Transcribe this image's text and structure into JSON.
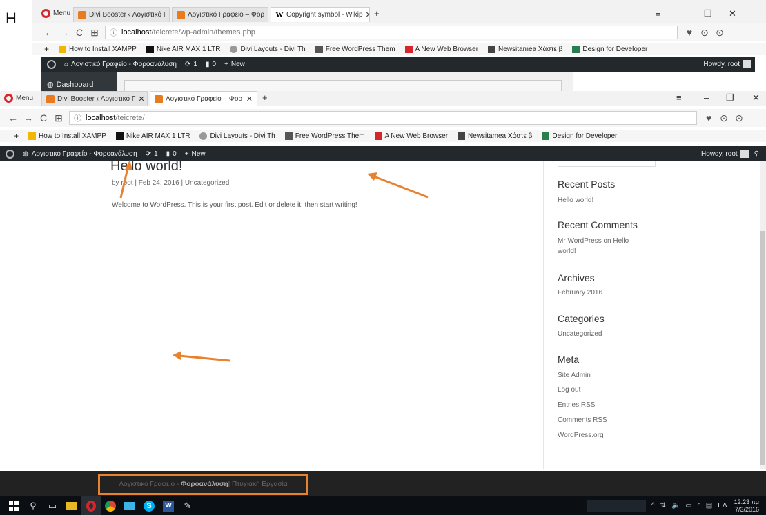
{
  "corner_letter": "H",
  "back_window": {
    "menu_label": "Menu",
    "tabs": [
      {
        "title": "Divi Booster ‹ Λογιστικό Γ",
        "icon": "orange-favicon",
        "active": false
      },
      {
        "title": "Λογιστικό Γραφείο – Φορ",
        "icon": "orange-favicon",
        "active": false
      },
      {
        "title": "Copyright symbol - Wikip",
        "icon": "wiki-favicon",
        "active": true
      }
    ],
    "url": {
      "domain": "localhost",
      "path": "/teicrete/wp-admin/themes.php"
    },
    "bookmarks": [
      {
        "label": "How to Install XAMPP",
        "icon_color": "#f2b705"
      },
      {
        "label": "Nike AIR MAX 1 LTR",
        "icon_color": "#111111"
      },
      {
        "label": "Divi Layouts - Divi Th",
        "icon_color": "#999999"
      },
      {
        "label": "Free WordPress Them",
        "icon_color": "#555555"
      },
      {
        "label": "A New Web Browser",
        "icon_color": "#d6262b"
      },
      {
        "label": "Newsitamea Χάστε β",
        "icon_color": "#444444"
      },
      {
        "label": "Design for Developer",
        "icon_color": "#2a7d4f"
      }
    ],
    "admin_bar": {
      "site": "Λογιστικό Γραφείο - Φοροανάλυση",
      "updates": "1",
      "comments": "0",
      "new": "New",
      "howdy": "Howdy, root"
    },
    "dashboard_label": "Dashboard"
  },
  "front_window": {
    "menu_label": "Menu",
    "tabs": [
      {
        "title": "Divi Booster ‹ Λογιστικό Γ",
        "active": false
      },
      {
        "title": "Λογιστικό Γραφείο – Φορ",
        "active": true
      }
    ],
    "url": {
      "domain": "localhost",
      "path": "/teicrete/"
    },
    "bookmarks": [
      {
        "label": "How to Install XAMPP",
        "icon_color": "#f2b705"
      },
      {
        "label": "Nike AIR MAX 1 LTR",
        "icon_color": "#111111"
      },
      {
        "label": "Divi Layouts - Divi Th",
        "icon_color": "#999999"
      },
      {
        "label": "Free WordPress Them",
        "icon_color": "#555555"
      },
      {
        "label": "A New Web Browser",
        "icon_color": "#d6262b"
      },
      {
        "label": "Newsitamea Χάστε β",
        "icon_color": "#444444"
      },
      {
        "label": "Design for Developer",
        "icon_color": "#2a7d4f"
      }
    ],
    "admin_bar": {
      "site": "Λογιστικό Γραφείο - Φοροανάλυση",
      "updates": "1",
      "comments": "0",
      "new": "New",
      "howdy": "Howdy, root"
    }
  },
  "post": {
    "title": "Hello world!",
    "meta": "by root | Feb 24, 2016 | Uncategorized",
    "body": "Welcome to WordPress. This is your first post. Edit or delete it, then start writing!"
  },
  "sidebar": {
    "recent_posts": {
      "title": "Recent Posts",
      "items": [
        "Hello world!"
      ]
    },
    "recent_comments": {
      "title": "Recent Comments",
      "items": [
        "Mr WordPress on Hello world!"
      ]
    },
    "archives": {
      "title": "Archives",
      "items": [
        "February 2016"
      ]
    },
    "categories": {
      "title": "Categories",
      "items": [
        "Uncategorized"
      ]
    },
    "meta": {
      "title": "Meta",
      "items": [
        "Site Admin",
        "Log out",
        "Entries RSS",
        "Comments RSS",
        "WordPress.org"
      ]
    }
  },
  "footer": {
    "site_name": "Λογιστικό Γραφείο - ",
    "site_bold": "Φοροανάλυση",
    "suffix": " | Πτυχιακή Εργασία"
  },
  "taskbar": {
    "lang": "ΕΛ",
    "time": "12:23 πμ",
    "date": "7/3/2016"
  },
  "colors": {
    "annotation": "#e8822f",
    "wp_bar": "#23282d",
    "footer": "#222222"
  }
}
